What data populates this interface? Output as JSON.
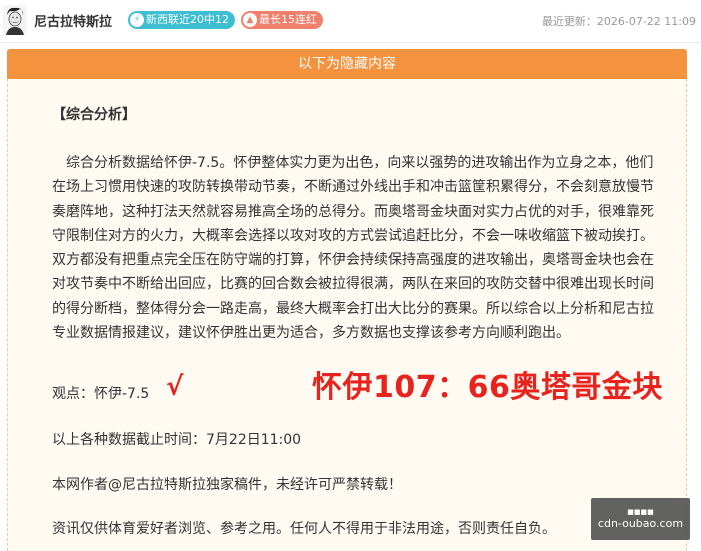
{
  "header": {
    "author": "尼古拉特斯拉",
    "badge_recent": "新西联近20中12",
    "badge_streak": "最长15连红",
    "last_updated": "最近更新：2026-07-22 11:09",
    "colors": {
      "badge_recent": "#3dbfd1",
      "badge_streak": "#f0806b"
    }
  },
  "hidden_bar": {
    "label": "以下为隐藏内容",
    "color": "#f5923e"
  },
  "article": {
    "section_title": "【综合分析】",
    "paragraph": "综合分析数据给怀伊-7.5。怀伊整体实力更为出色，向来以强势的进攻输出作为立身之本，他们在场上习惯用快速的攻防转换带动节奏，不断通过外线出手和冲击篮筐积累得分，不会刻意放慢节奏磨阵地，这种打法天然就容易推高全场的总得分。而奥塔哥金块面对实力占优的对手，很难靠死守限制住对方的火力，大概率会选择以攻对攻的方式尝试追赶比分，不会一味收缩篮下被动挨打。双方都没有把重点完全压在防守端的打算，怀伊会持续保持高强度的进攻输出，奥塔哥金块也会在对攻节奏中不断给出回应，比赛的回合数会被拉得很满，两队在来回的攻防交替中很难出现长时间的得分断档，整体得分会一路走高，最终大概率会打出大比分的赛果。所以综合以上分析和尼古拉专业数据情报建议，建议怀伊胜出更为适合，多方数据也支撑该参考方向顺利跑出。",
    "opinion": "观点：怀伊-7.5",
    "check_mark": "√",
    "final_score": "怀伊107：66奥塔哥金块",
    "cutoff": "以上各种数据截止时间：7月22日11:00",
    "copyright": "本网作者@尼古拉特斯拉独家稿件，未经许可严禁转载！",
    "disclaimer": "资讯仅供体育爱好者浏览、参考之用。任何人不得用于非法用途，否则责任自负。"
  },
  "watermark": {
    "top": "■■■■",
    "bottom": "cdn-oubao.com"
  }
}
